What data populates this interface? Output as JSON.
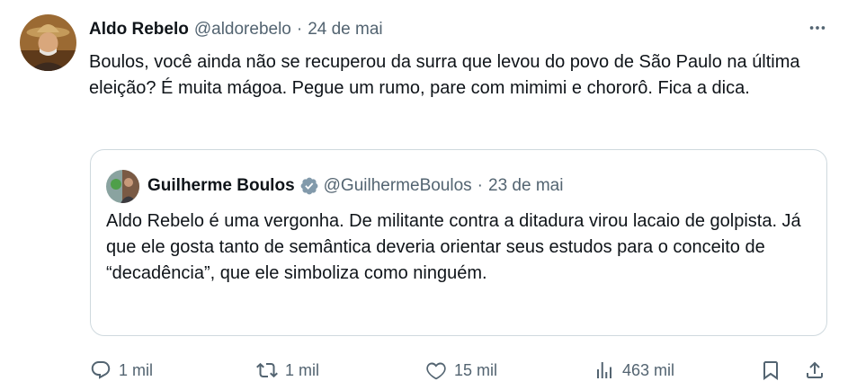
{
  "author": {
    "name": "Aldo Rebelo",
    "handle": "@aldorebelo",
    "separator": "·",
    "date": "24 de mai"
  },
  "tweet": {
    "text": "Boulos, você ainda não se recuperou da surra que levou do povo de São Paulo na última eleição? É muita mágoa. Pegue um rumo, pare com mimimi e chororô. Fica a dica."
  },
  "quoted": {
    "name": "Guilherme Boulos",
    "handle": "@GuilhermeBoulos",
    "separator": "·",
    "date": "23 de mai",
    "text": "Aldo Rebelo é uma vergonha. De militante contra a ditadura virou lacaio de golpista. Já que ele gosta tanto de semântica deveria orientar seus estudos para o conceito de “decadência”, que ele simboliza como ninguém."
  },
  "actions": {
    "replies": "1 mil",
    "reposts": "1 mil",
    "likes": "15 mil",
    "views": "463 mil"
  },
  "colors": {
    "text": "#0f1419",
    "secondary": "#536471",
    "border": "#cfd9de",
    "verified": "#829aab"
  },
  "icons": [
    "more-icon",
    "verified-icon",
    "reply-icon",
    "repost-icon",
    "like-icon",
    "views-icon",
    "bookmark-icon",
    "share-icon"
  ]
}
